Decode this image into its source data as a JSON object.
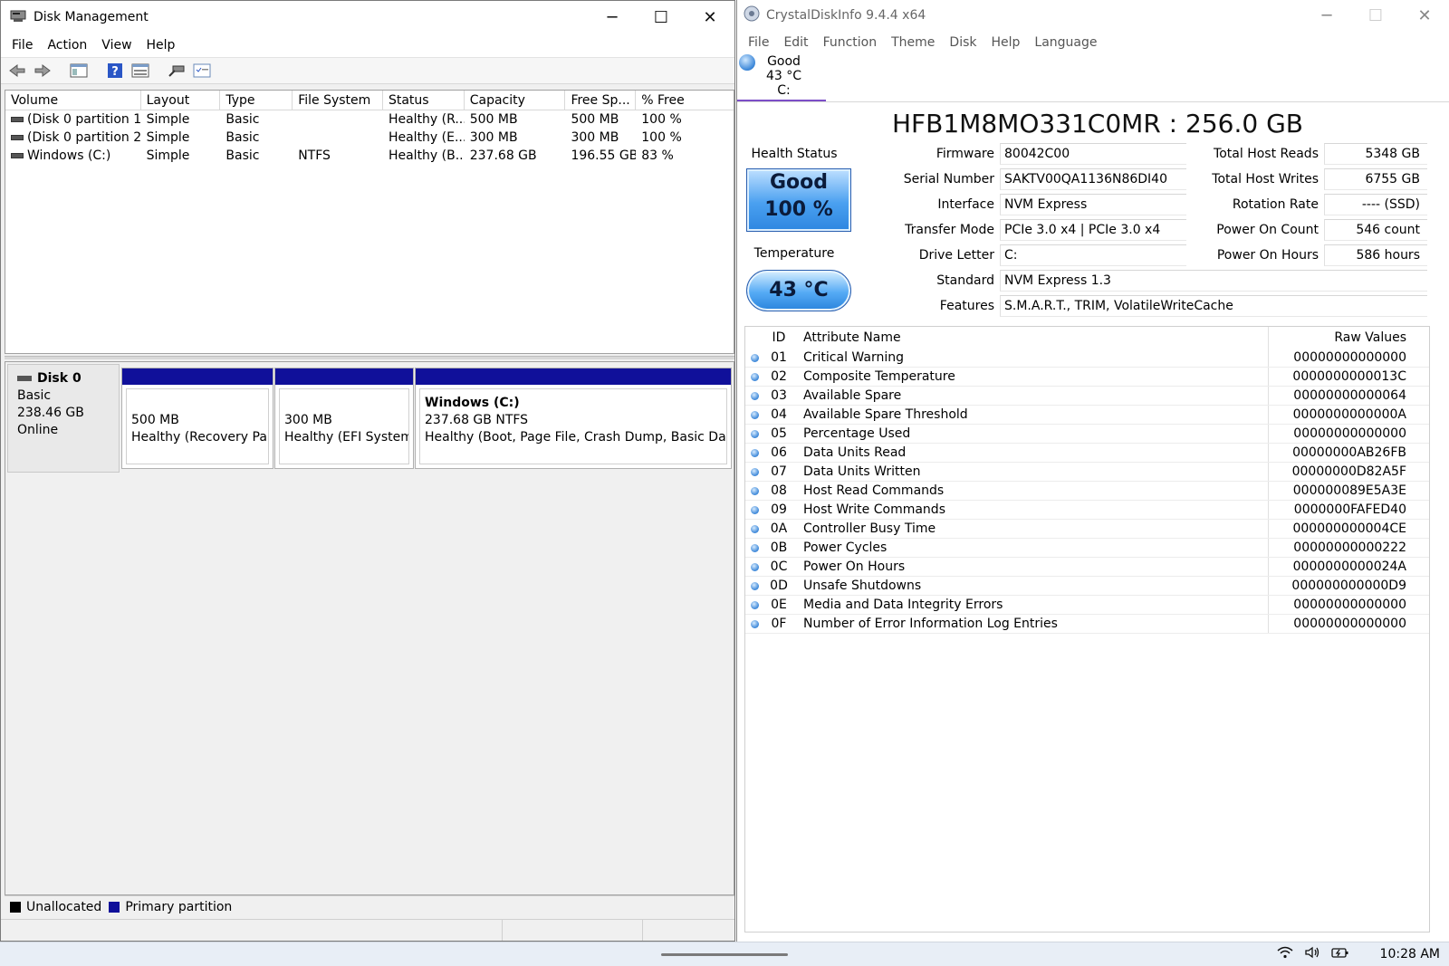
{
  "disk_mgmt": {
    "title": "Disk Management",
    "menu": [
      "File",
      "Action",
      "View",
      "Help"
    ],
    "columns": [
      "Volume",
      "Layout",
      "Type",
      "File System",
      "Status",
      "Capacity",
      "Free Sp...",
      "% Free"
    ],
    "volumes": [
      {
        "volume": "(Disk 0 partition 1)",
        "layout": "Simple",
        "type": "Basic",
        "fs": "",
        "status": "Healthy (R...",
        "capacity": "500 MB",
        "free": "500 MB",
        "pct": "100 %"
      },
      {
        "volume": "(Disk 0 partition 2)",
        "layout": "Simple",
        "type": "Basic",
        "fs": "",
        "status": "Healthy (E...",
        "capacity": "300 MB",
        "free": "300 MB",
        "pct": "100 %"
      },
      {
        "volume": "Windows (C:)",
        "layout": "Simple",
        "type": "Basic",
        "fs": "NTFS",
        "status": "Healthy (B...",
        "capacity": "237.68 GB",
        "free": "196.55 GB",
        "pct": "83 %"
      }
    ],
    "disk": {
      "name": "Disk 0",
      "type": "Basic",
      "size": "238.46 GB",
      "state": "Online"
    },
    "partitions": [
      {
        "title": "",
        "size": "500 MB",
        "status": "Healthy (Recovery Partiti"
      },
      {
        "title": "",
        "size": "300 MB",
        "status": "Healthy (EFI System Pa"
      },
      {
        "title": "Windows  (C:)",
        "size": "237.68 GB NTFS",
        "status": "Healthy (Boot, Page File, Crash Dump, Basic Data Par"
      }
    ],
    "legend": {
      "unallocated": "Unallocated",
      "primary": "Primary partition"
    },
    "colors": {
      "primary": "#10109a",
      "unallocated": "#000000"
    }
  },
  "cdi": {
    "title": "CrystalDiskInfo 9.4.4 x64",
    "menu": [
      "File",
      "Edit",
      "Function",
      "Theme",
      "Disk",
      "Help",
      "Language"
    ],
    "tab": {
      "status": "Good",
      "temp": "43 °C",
      "letter": "C:"
    },
    "model": "HFB1M8MO331C0MR : 256.0 GB",
    "health_label": "Health Status",
    "health_status": "Good",
    "health_pct": "100 %",
    "temp_label": "Temperature",
    "temp_value": "43 °C",
    "fields_left": [
      {
        "k": "Firmware",
        "v": "80042C00"
      },
      {
        "k": "Serial Number",
        "v": "SAKTV00QA1136N86DI40"
      },
      {
        "k": "Interface",
        "v": "NVM Express"
      },
      {
        "k": "Transfer Mode",
        "v": "PCIe 3.0 x4 | PCIe 3.0 x4"
      },
      {
        "k": "Drive Letter",
        "v": "C:"
      }
    ],
    "fields_right": [
      {
        "k": "Total Host Reads",
        "v": "5348 GB"
      },
      {
        "k": "Total Host Writes",
        "v": "6755 GB"
      },
      {
        "k": "Rotation Rate",
        "v": "---- (SSD)"
      },
      {
        "k": "Power On Count",
        "v": "546 count"
      },
      {
        "k": "Power On Hours",
        "v": "586 hours"
      }
    ],
    "standard": {
      "k": "Standard",
      "v": "NVM Express 1.3"
    },
    "features": {
      "k": "Features",
      "v": "S.M.A.R.T., TRIM, VolatileWriteCache"
    },
    "attr_headers": {
      "id": "ID",
      "name": "Attribute Name",
      "raw": "Raw Values"
    },
    "attributes": [
      {
        "id": "01",
        "name": "Critical Warning",
        "raw": "00000000000000"
      },
      {
        "id": "02",
        "name": "Composite Temperature",
        "raw": "0000000000013C"
      },
      {
        "id": "03",
        "name": "Available Spare",
        "raw": "00000000000064"
      },
      {
        "id": "04",
        "name": "Available Spare Threshold",
        "raw": "0000000000000A"
      },
      {
        "id": "05",
        "name": "Percentage Used",
        "raw": "00000000000000"
      },
      {
        "id": "06",
        "name": "Data Units Read",
        "raw": "00000000AB26FB"
      },
      {
        "id": "07",
        "name": "Data Units Written",
        "raw": "00000000D82A5F"
      },
      {
        "id": "08",
        "name": "Host Read Commands",
        "raw": "000000089E5A3E"
      },
      {
        "id": "09",
        "name": "Host Write Commands",
        "raw": "0000000FAFED40"
      },
      {
        "id": "0A",
        "name": "Controller Busy Time",
        "raw": "000000000004CE"
      },
      {
        "id": "0B",
        "name": "Power Cycles",
        "raw": "00000000000222"
      },
      {
        "id": "0C",
        "name": "Power On Hours",
        "raw": "0000000000024A"
      },
      {
        "id": "0D",
        "name": "Unsafe Shutdowns",
        "raw": "000000000000D9"
      },
      {
        "id": "0E",
        "name": "Media and Data Integrity Errors",
        "raw": "00000000000000"
      },
      {
        "id": "0F",
        "name": "Number of Error Information Log Entries",
        "raw": "00000000000000"
      }
    ]
  },
  "taskbar": {
    "time": "10:28 AM",
    "icons": [
      "wifi-icon",
      "speaker-icon",
      "battery-icon"
    ]
  }
}
